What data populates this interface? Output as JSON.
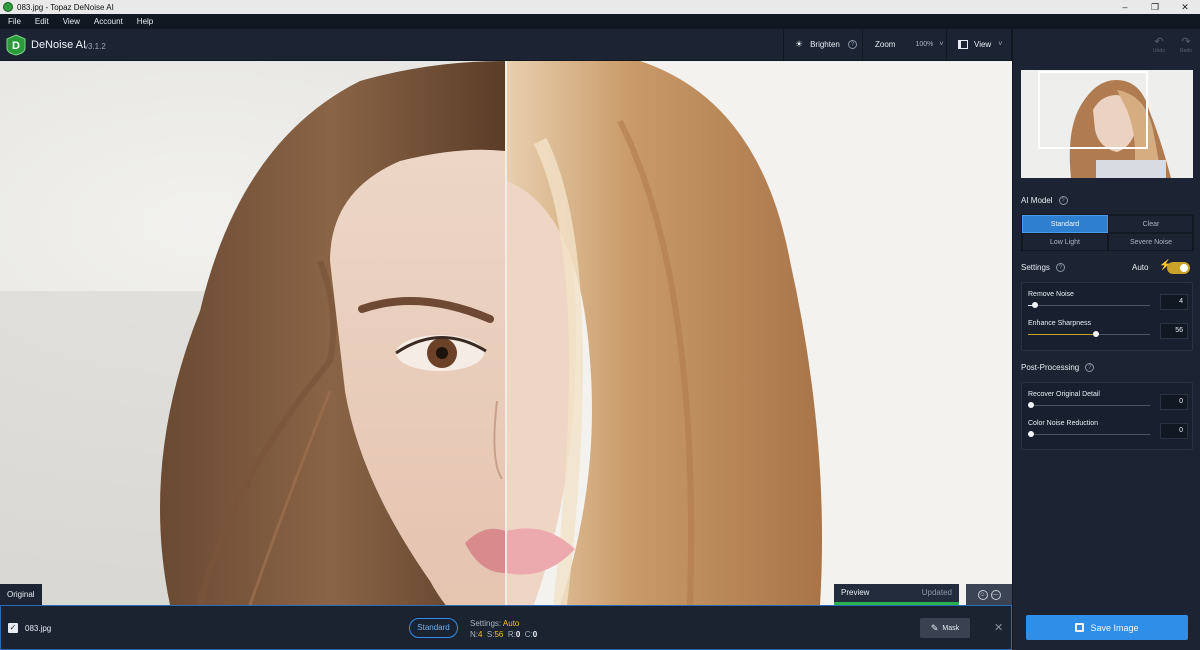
{
  "window": {
    "title": "083.jpg - Topaz DeNoise AI"
  },
  "menu": [
    "File",
    "Edit",
    "View",
    "Account",
    "Help"
  ],
  "header": {
    "brand": "DeNoise AI",
    "version": "v3.1.2",
    "brighten": "Brighten",
    "zoom_label": "Zoom",
    "zoom_value": "100%",
    "view_label": "View"
  },
  "undo": {
    "undo": "Undo",
    "redo": "Redo"
  },
  "viewer": {
    "left_label": "Original",
    "preview_label": "Preview",
    "preview_status": "Updated"
  },
  "ai_model": {
    "title": "AI Model",
    "options": [
      "Standard",
      "Clear",
      "Low Light",
      "Severe Noise"
    ],
    "selected": "Standard"
  },
  "settings": {
    "title": "Settings",
    "auto_label": "Auto",
    "auto_enabled": true,
    "remove_noise": {
      "label": "Remove Noise",
      "value": "4"
    },
    "enhance_sharpness": {
      "label": "Enhance Sharpness",
      "value": "56"
    }
  },
  "post_processing": {
    "title": "Post-Processing",
    "recover_detail": {
      "label": "Recover Original Detail",
      "value": "0"
    },
    "color_noise": {
      "label": "Color Noise Reduction",
      "value": "0"
    }
  },
  "bottom": {
    "filename": "083.jpg",
    "model": "Standard",
    "settings_label": "Settings:",
    "settings_value": "Auto",
    "n_label": "N:",
    "n_value": "4",
    "s_label": "S:",
    "s_value": "56",
    "r_label": "R:",
    "r_value": "0",
    "c_label": "C:",
    "c_value": "0",
    "mask": "Mask"
  },
  "save_button": "Save Image",
  "colors": {
    "accent": "#2f8fe8",
    "panel": "#1c2433",
    "auto_toggle": "#c9a227",
    "preview_ok": "#29b14a"
  }
}
